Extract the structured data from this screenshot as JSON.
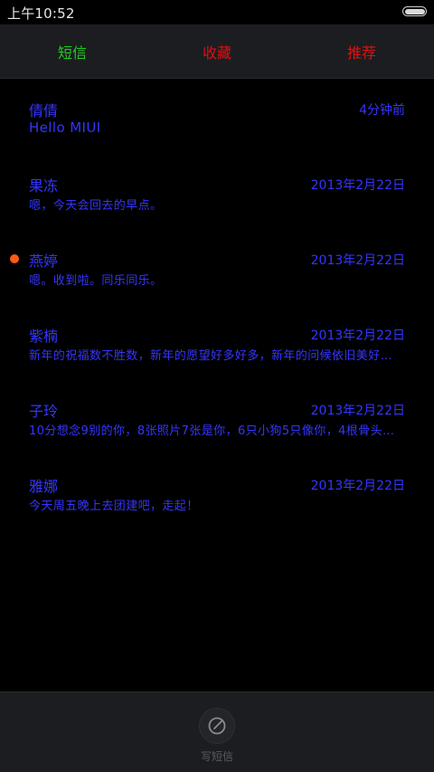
{
  "status_bar": {
    "time": "上午10:52"
  },
  "tabs": [
    {
      "label": "短信",
      "color": "#22cc22"
    },
    {
      "label": "收藏",
      "color": "#e01010"
    },
    {
      "label": "推荐",
      "color": "#e01010"
    }
  ],
  "conversations": [
    {
      "name": "倩倩",
      "date": "4分钟前",
      "preview": "Hello MIUI",
      "unread": false
    },
    {
      "name": "果冻",
      "date": "2013年2月22日",
      "preview": "嗯，今天会回去的早点。",
      "unread": false
    },
    {
      "name": "燕婷",
      "date": "2013年2月22日",
      "preview": "嗯。收到啦。同乐同乐。",
      "unread": true
    },
    {
      "name": "紫楠",
      "date": "2013年2月22日",
      "preview": "新年的祝福数不胜数，新年的愿望好多好多，新年的问候依旧美好…",
      "unread": false
    },
    {
      "name": "子玲",
      "date": "2013年2月22日",
      "preview": "10分想念9别的你，8张照片7张是你，6只小狗5只像你，4根骨头…",
      "unread": false
    },
    {
      "name": "雅娜",
      "date": "2013年2月22日",
      "preview": "今天周五晚上去团建吧，走起！",
      "unread": false
    }
  ],
  "bottom_bar": {
    "compose_label": "写短信",
    "compose_icon": "compose-icon"
  },
  "colors": {
    "text_accent": "#3535ff",
    "unread_dot": "#ff5a16",
    "background": "#000000",
    "bar_background": "#1c1d20"
  }
}
